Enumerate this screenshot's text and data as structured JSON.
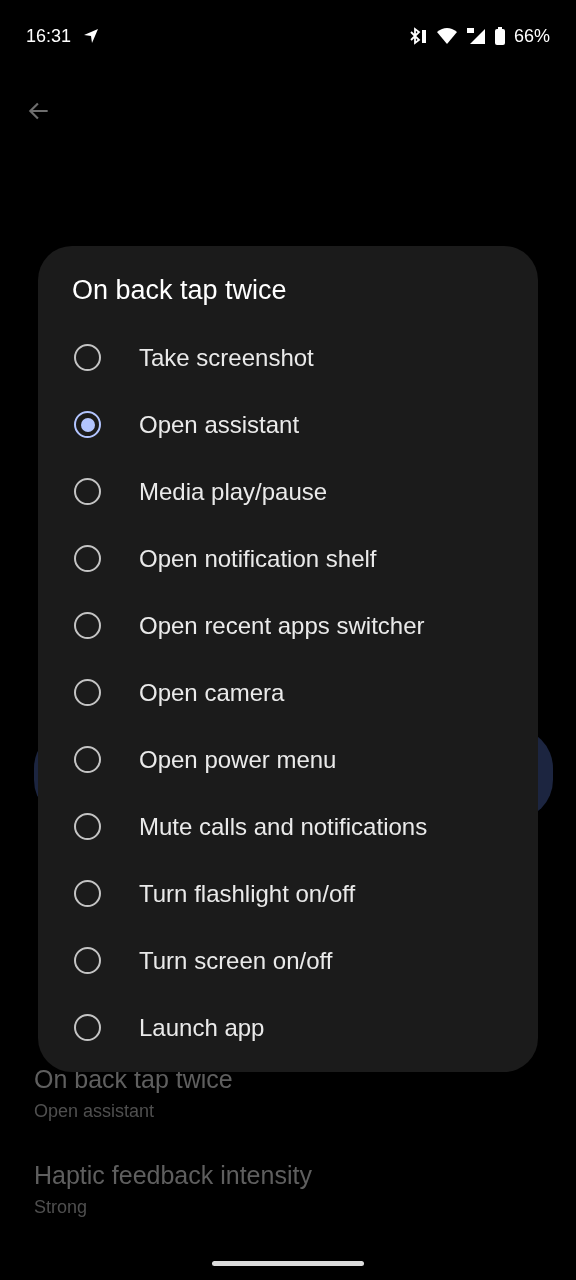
{
  "status_bar": {
    "time": "16:31",
    "battery": "66%"
  },
  "settings": [
    {
      "title": "On back tap twice",
      "summary": "Open assistant"
    },
    {
      "title": "Haptic feedback intensity",
      "summary": "Strong"
    }
  ],
  "dialog": {
    "title": "On back tap twice",
    "options": [
      {
        "label": "Take screenshot",
        "selected": false
      },
      {
        "label": "Open assistant",
        "selected": true
      },
      {
        "label": "Media play/pause",
        "selected": false
      },
      {
        "label": "Open notification shelf",
        "selected": false
      },
      {
        "label": "Open recent apps switcher",
        "selected": false
      },
      {
        "label": "Open camera",
        "selected": false
      },
      {
        "label": "Open power menu",
        "selected": false
      },
      {
        "label": "Mute calls and notifications",
        "selected": false
      },
      {
        "label": "Turn flashlight on/off",
        "selected": false
      },
      {
        "label": "Turn screen on/off",
        "selected": false
      },
      {
        "label": "Launch app",
        "selected": false
      }
    ]
  }
}
